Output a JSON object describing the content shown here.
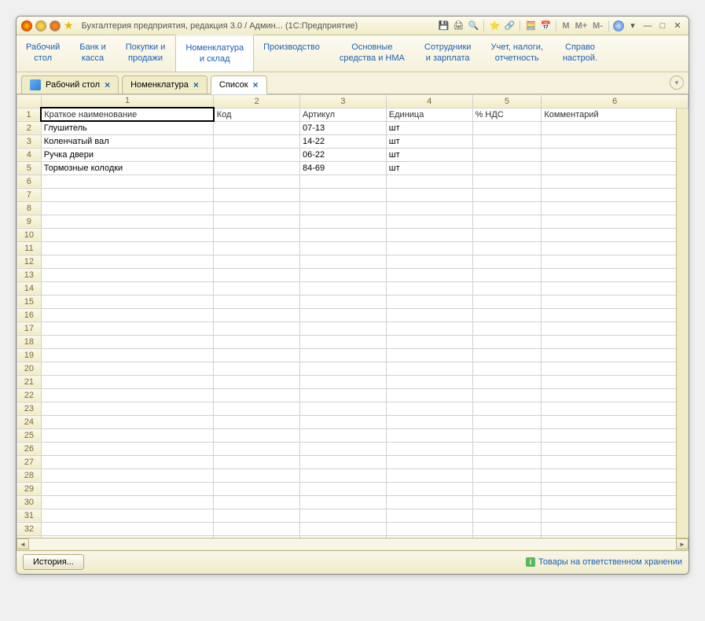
{
  "title": "Бухгалтерия предприятия, редакция 3.0 / Админ...  (1С:Предприятие)",
  "nav": [
    {
      "l1": "Рабочий",
      "l2": "стол"
    },
    {
      "l1": "Банк и",
      "l2": "касса"
    },
    {
      "l1": "Покупки и",
      "l2": "продажи"
    },
    {
      "l1": "Номенклатура",
      "l2": "и склад"
    },
    {
      "l1": "Производство",
      "l2": ""
    },
    {
      "l1": "Основные",
      "l2": "средства и НМА"
    },
    {
      "l1": "Сотрудники",
      "l2": "и зарплата"
    },
    {
      "l1": "Учет, налоги,",
      "l2": "отчетность"
    },
    {
      "l1": "Справо",
      "l2": "настрой."
    }
  ],
  "tabs": [
    {
      "label": "Рабочий стол"
    },
    {
      "label": "Номенклатура"
    },
    {
      "label": "Список"
    }
  ],
  "colheads": [
    "1",
    "2",
    "3",
    "4",
    "5",
    "6"
  ],
  "headers": [
    "Краткое наименование",
    "Код",
    "Артикул",
    "Единица",
    "% НДС",
    "Комментарий"
  ],
  "rows": [
    {
      "name": "Глушитель",
      "code": "",
      "art": "07-13",
      "unit": "шт",
      "vat": "",
      "comm": ""
    },
    {
      "name": "Коленчатый вал",
      "code": "",
      "art": "14-22",
      "unit": "шт",
      "vat": "",
      "comm": ""
    },
    {
      "name": "Ручка двери",
      "code": "",
      "art": "06-22",
      "unit": "шт",
      "vat": "",
      "comm": ""
    },
    {
      "name": "Тормозные колодки",
      "code": "",
      "art": "84-69",
      "unit": "шт",
      "vat": "",
      "comm": ""
    }
  ],
  "emptyRows": 32,
  "status": {
    "history": "История...",
    "link": "Товары на ответственном хранении"
  }
}
